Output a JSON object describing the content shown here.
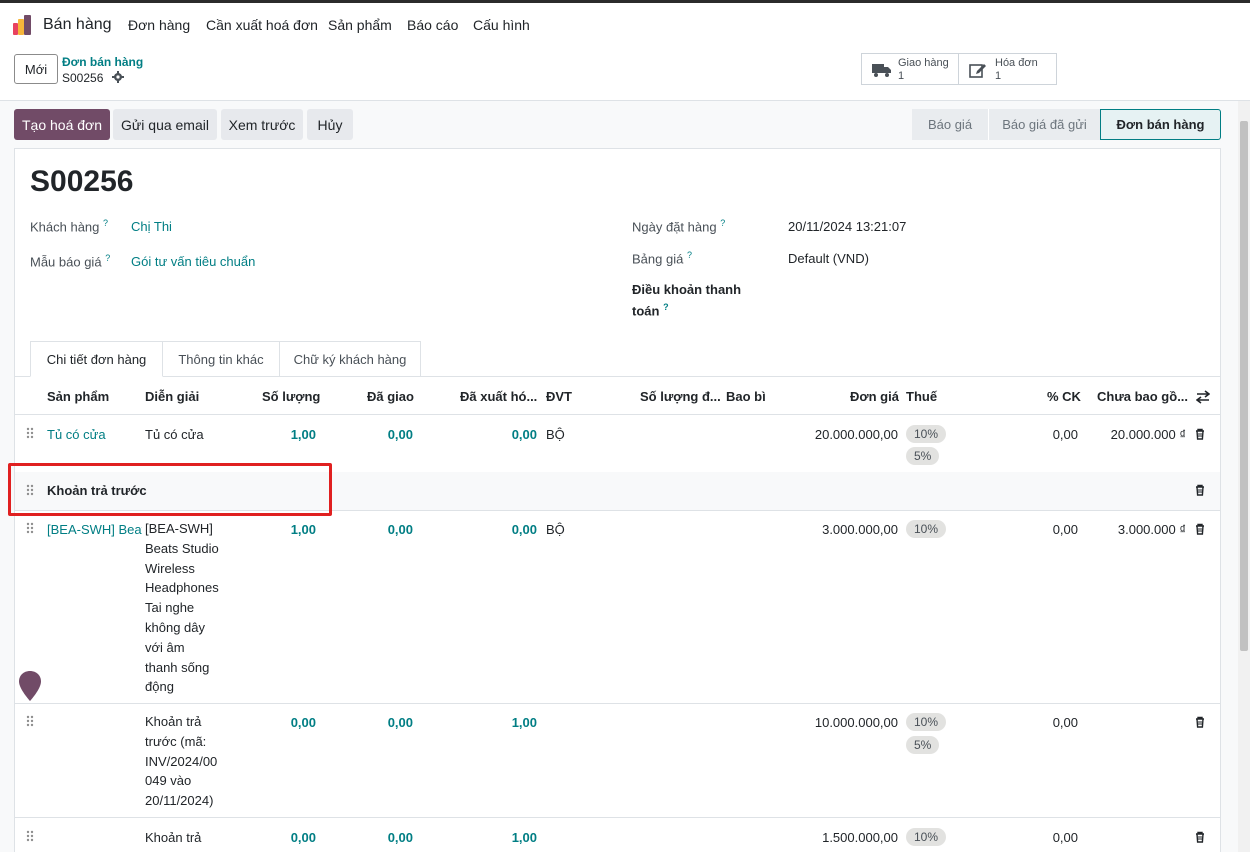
{
  "navbar": {
    "app_name": "Bán hàng",
    "menus": [
      "Đơn hàng",
      "Cần xuất hoá đơn",
      "Sản phẩm",
      "Báo cáo",
      "Cấu hình"
    ]
  },
  "control_panel": {
    "new_label": "Mới",
    "breadcrumb_parent": "Đơn bán hàng",
    "breadcrumb_current": "S00256",
    "smart_buttons": [
      {
        "title": "Giao hàng",
        "value": "1",
        "icon": "truck-icon"
      },
      {
        "title": "Hóa đơn",
        "value": "1",
        "icon": "pencil-square-icon"
      }
    ]
  },
  "actions": {
    "create_invoice": "Tạo hoá đơn",
    "send_email": "Gửi qua email",
    "preview": "Xem trước",
    "cancel": "Hủy"
  },
  "statusbar": [
    "Báo giá",
    "Báo giá đã gửi",
    "Đơn bán hàng"
  ],
  "form": {
    "title": "S00256",
    "customer_label": "Khách hàng",
    "customer_value": "Chị Thi",
    "template_label": "Mẫu báo giá",
    "template_value": "Gói tư vấn tiêu chuẩn",
    "order_date_label": "Ngày đặt hàng",
    "order_date_value": "20/11/2024 13:21:07",
    "pricelist_label": "Bảng giá",
    "pricelist_value": "Default (VND)",
    "payment_terms_label_1": "Điều khoản thanh",
    "payment_terms_label_2": "toán",
    "help_mark": "?"
  },
  "tabs": [
    "Chi tiết đơn hàng",
    "Thông tin khác",
    "Chữ ký khách hàng"
  ],
  "table": {
    "headers": [
      "Sản phẩm",
      "Diễn giải",
      "Số lượng",
      "Đã giao",
      "Đã xuất hó...",
      "ĐVT",
      "Số lượng đ...",
      "Bao bì",
      "Đơn giá",
      "Thuế",
      "% CK",
      "Chưa bao gồ..."
    ],
    "rows": [
      {
        "product": "Tủ có cửa",
        "description": "Tủ có cửa",
        "qty": "1,00",
        "delivered": "0,00",
        "invoiced": "0,00",
        "uom": "BỘ",
        "price": "20.000.000,00",
        "taxes": [
          "10%",
          "5%"
        ],
        "discount": "0,00",
        "subtotal": "20.000.000 ₫"
      },
      {
        "section": "Khoản trả trước"
      },
      {
        "product": "[BEA-SWH] Beat",
        "description_lines": [
          "[BEA-SWH]",
          "Beats Studio",
          "Wireless",
          "Headphones",
          "Tai nghe",
          "không dây",
          "với âm",
          "thanh sống",
          "động"
        ],
        "qty": "1,00",
        "delivered": "0,00",
        "invoiced": "0,00",
        "uom": "BỘ",
        "price": "3.000.000,00",
        "taxes": [
          "10%"
        ],
        "discount": "0,00",
        "subtotal": "3.000.000 ₫"
      },
      {
        "product": "",
        "description_lines": [
          "Khoản trả",
          "trước (mã:",
          "INV/2024/00",
          "049 vào",
          "20/11/2024)"
        ],
        "qty": "0,00",
        "delivered": "0,00",
        "invoiced": "1,00",
        "uom": "",
        "price": "10.000.000,00",
        "taxes": [
          "10%",
          "5%"
        ],
        "discount": "0,00",
        "subtotal": ""
      },
      {
        "product": "",
        "description_lines": [
          "Khoản trả"
        ],
        "qty": "0,00",
        "delivered": "0,00",
        "invoiced": "1,00",
        "uom": "",
        "price": "1.500.000,00",
        "taxes": [
          "10%"
        ],
        "discount": "0,00",
        "subtotal": ""
      }
    ]
  },
  "colors": {
    "primary": "#714b67",
    "link": "#017e84",
    "highlight_box": "#e02020"
  }
}
